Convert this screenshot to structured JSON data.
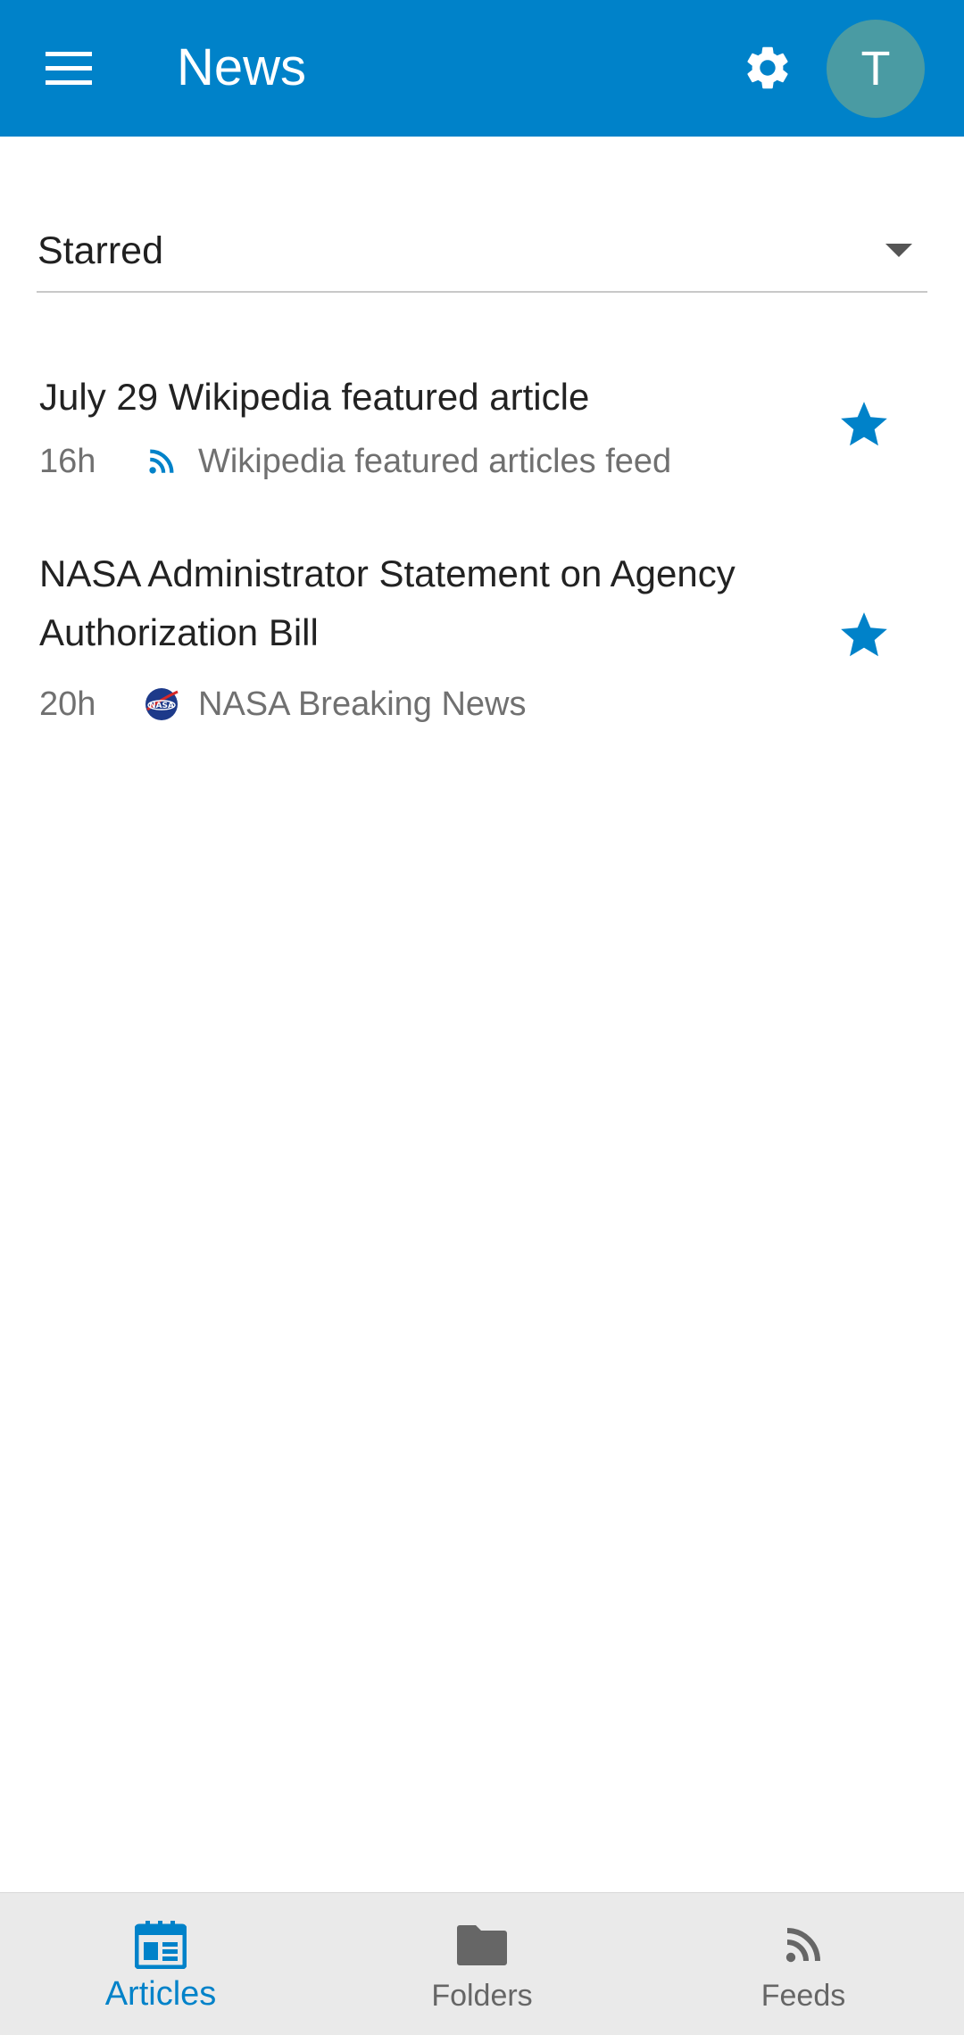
{
  "appbar": {
    "title": "News",
    "avatar_letter": "T",
    "menu_icon": "menu-icon",
    "settings_icon": "gear-icon"
  },
  "filter": {
    "selected": "Starred"
  },
  "articles": [
    {
      "title": "July 29 Wikipedia featured article",
      "age": "16h",
      "feed": "Wikipedia featured articles feed",
      "feed_icon": "rss-icon",
      "starred": true
    },
    {
      "title": "NASA Administrator Statement on Agency Authorization Bill",
      "age": "20h",
      "feed": "NASA Breaking News",
      "feed_icon": "nasa-logo-icon",
      "starred": true
    }
  ],
  "bottom_nav": {
    "articles": "Articles",
    "folders": "Folders",
    "feeds": "Feeds",
    "active": "articles"
  },
  "colors": {
    "primary": "#0082c9",
    "avatar": "#4a9ba3",
    "nav_background": "#eaeaea",
    "secondary_text": "#707070"
  }
}
